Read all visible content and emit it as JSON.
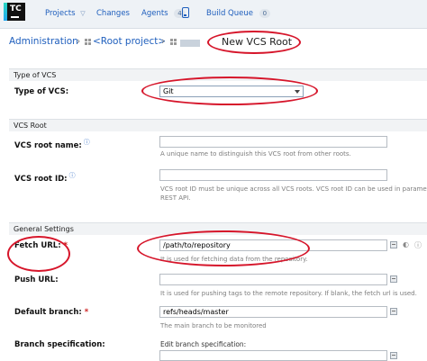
{
  "nav": {
    "logo_text": "TC",
    "projects_label": "Projects",
    "projects_arrow": "▽",
    "changes_label": "Changes",
    "agents_label": "Agents",
    "agents_count": "4",
    "queue_label": "Build Queue",
    "queue_count": "0"
  },
  "breadcrumb": {
    "admin": "Administration",
    "root": "<Root project>",
    "separator": "›",
    "current": "New VCS Root"
  },
  "sections": {
    "type_of_vcs": "Type of VCS",
    "vcs_root": "VCS Root",
    "general": "General Settings"
  },
  "type_of_vcs": {
    "label": "Type of VCS:",
    "selected": "Git"
  },
  "vcs_root_name": {
    "label": "VCS root name:",
    "value": "",
    "hint": "A unique name to distinguish this VCS root from other roots."
  },
  "vcs_root_id": {
    "label": "VCS root ID:",
    "value": "",
    "hint_line1": "VCS root ID must be unique across all VCS roots. VCS root ID can be used in paramete",
    "hint_line2": "REST API."
  },
  "fetch_url": {
    "label": "Fetch URL:",
    "required": "*",
    "value": "/path/to/repository",
    "hint": "It is used for fetching data from the repository."
  },
  "push_url": {
    "label": "Push URL:",
    "value": "",
    "hint": "It is used for pushing tags to the remote repository. If blank, the fetch url is used."
  },
  "default_branch": {
    "label": "Default branch:",
    "required": "*",
    "value": "refs/heads/master",
    "hint": "The main branch to be monitored"
  },
  "branch_spec": {
    "label": "Branch specification:",
    "placeholder": "Edit branch specification:"
  },
  "help_icon_glyph": "ⓘ",
  "colors": {
    "link": "#1f5fbd",
    "annotation": "#d6152a",
    "required": "#cc2222"
  }
}
